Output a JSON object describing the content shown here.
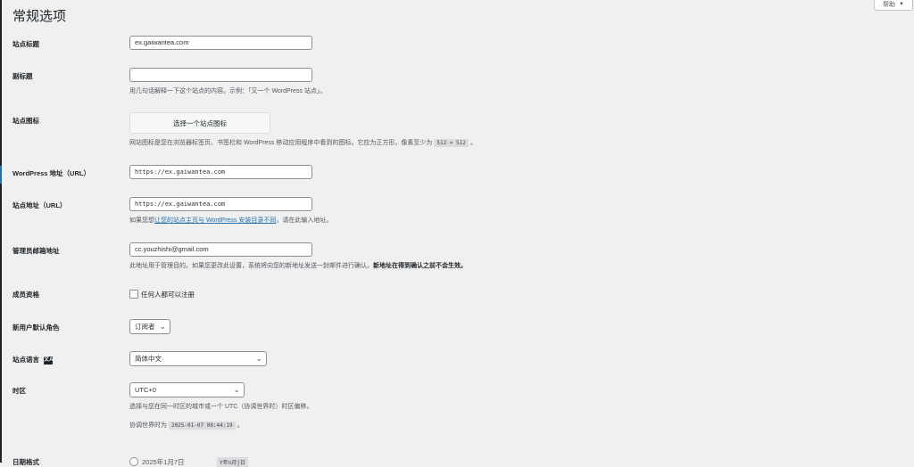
{
  "page": {
    "title": "常规选项"
  },
  "help_tab": {
    "label": "帮助",
    "caret": "▼"
  },
  "fields": {
    "site_title": {
      "label": "站点标题",
      "value": "ex.gaiwantea.com"
    },
    "tagline": {
      "label": "副标题",
      "value": "",
      "desc": "用几句话解释一下这个站点的内容。示例：「又一个 WordPress 站点」。"
    },
    "site_icon": {
      "label": "站点图标",
      "button": "选择一个站点图标",
      "desc_prefix": "网站图标是您在浏览器标签页、书签栏和 WordPress 移动应用程序中看到的图标。它应为正方形，像素至少为",
      "size_code": "512 × 512",
      "desc_suffix": "。"
    },
    "wp_url": {
      "label": "WordPress 地址（URL）",
      "value": "https://ex.gaiwantea.com"
    },
    "site_url": {
      "label": "站点地址（URL）",
      "value": "https://ex.gaiwantea.com",
      "desc_prefix": "如果您想",
      "desc_link": "让您的站点主页与 WordPress 安装目录不同",
      "desc_suffix": "，请在此输入地址。"
    },
    "admin_email": {
      "label": "管理员邮箱地址",
      "value": "cc.youzhishi@gmail.com",
      "desc": "此地址用于管理目的。如果您更改此设置，系统将向您的新地址发送一封邮件进行确认。",
      "desc_bold": "新地址在得到确认之前不会生效。"
    },
    "membership": {
      "label": "成员资格",
      "checkbox_label": "任何人都可以注册",
      "checked": false
    },
    "default_role": {
      "label": "新用户默认角色",
      "value": "订阅者"
    },
    "site_language": {
      "label": "站点语言",
      "icon": "translate-icon",
      "icon_glyph": "文A",
      "value": "简体中文"
    },
    "timezone": {
      "label": "时区",
      "value": "UTC+0",
      "desc": "选择与您在同一时区的城市或一个 UTC（协调世界时）时区偏移。",
      "utc_prefix": "协调世界时为",
      "utc_time": "2025-01-07 09:44:19",
      "utc_suffix": "。"
    },
    "date_format": {
      "label": "日期格式",
      "option_label": "2025年1月7日",
      "option_code": "Y年n月j日"
    }
  },
  "colors": {
    "link": "#2271b1",
    "text": "#1d2327",
    "background": "#f0f0f1"
  }
}
